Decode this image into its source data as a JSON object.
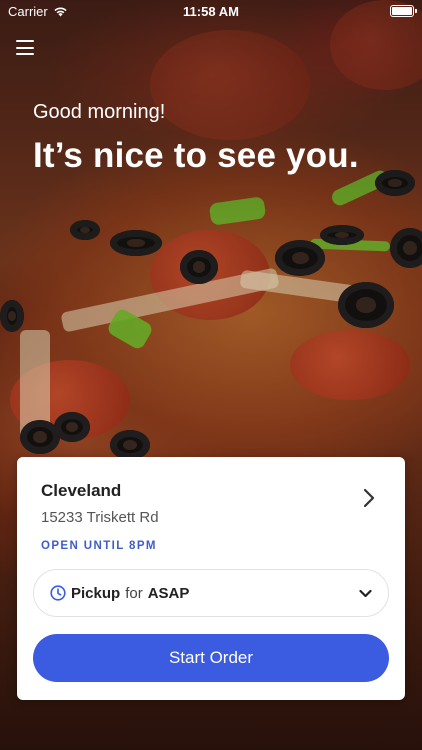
{
  "status_bar": {
    "carrier": "Carrier",
    "time": "11:58 AM"
  },
  "header": {
    "greeting": "Good morning!",
    "headline": "It’s nice to see you."
  },
  "store": {
    "name": "Cleveland",
    "address": "15233 Triskett Rd",
    "hours": "OPEN UNTIL 8PM"
  },
  "order_type": {
    "mode": "Pickup",
    "connector": "for",
    "time": "ASAP"
  },
  "actions": {
    "start_order": "Start Order"
  },
  "icons": {
    "menu": "hamburger-menu-icon",
    "store_chevron": "chevron-right-icon",
    "clock": "clock-icon",
    "dropdown": "chevron-down-icon",
    "wifi": "wifi-icon",
    "battery": "battery-icon"
  },
  "colors": {
    "accent": "#3b5be0",
    "hours_text": "#3e5ccf"
  }
}
